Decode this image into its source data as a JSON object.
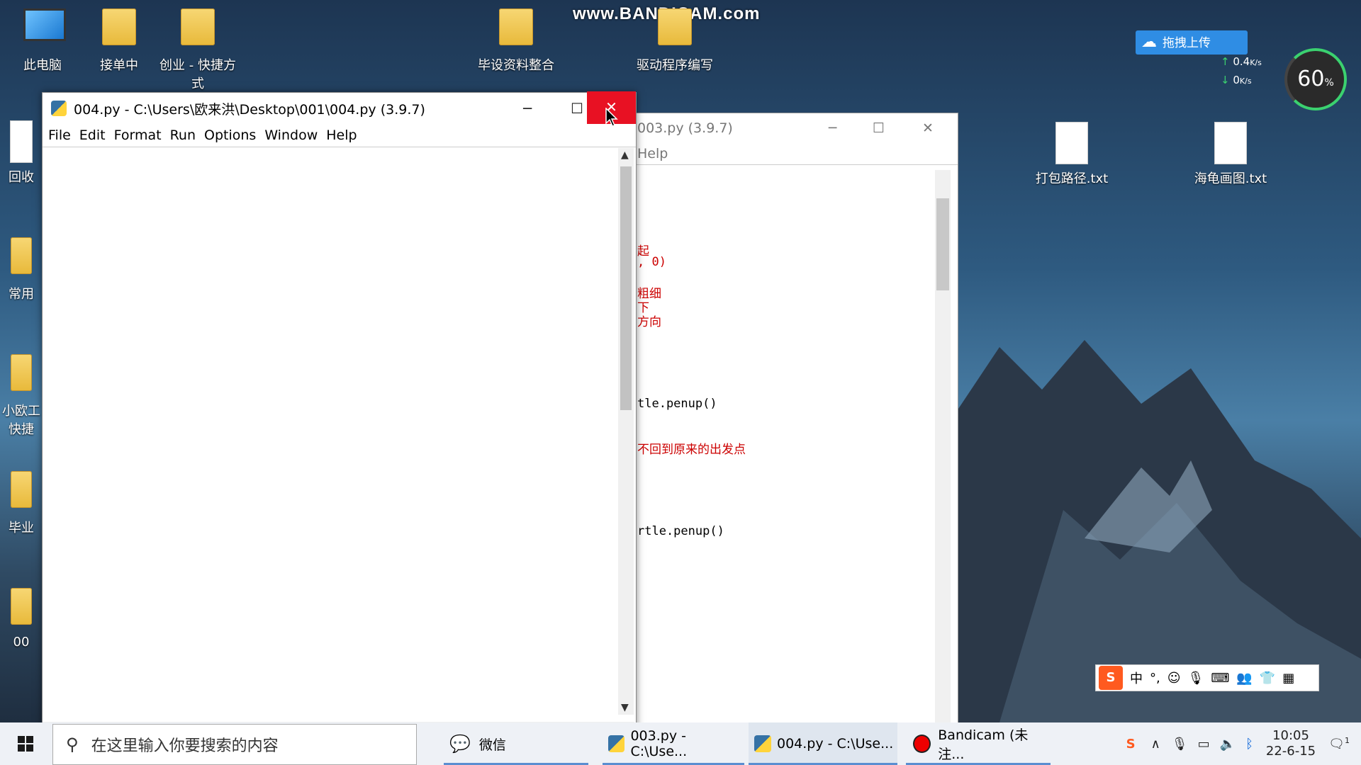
{
  "watermark": "www.BANDICAM.com",
  "desktop": {
    "icons_left": [
      {
        "label": "此电脑",
        "icon": "computer-icon"
      },
      {
        "label": "接单中",
        "icon": "folder-icon"
      },
      {
        "label": "创业 - 快捷方式",
        "icon": "folder-shortcut-icon"
      },
      {
        "label": "毕设资料整合",
        "icon": "folder-icon"
      },
      {
        "label": "驱动程序编写",
        "icon": "folder-icon"
      }
    ],
    "icons_partial": [
      "回收",
      "常用",
      "小欧工",
      "快捷",
      "毕业",
      "00"
    ],
    "icons_right": [
      {
        "label": "打包路径.txt",
        "icon": "text-file-icon"
      },
      {
        "label": "海龟画图.txt",
        "icon": "text-file-icon"
      }
    ]
  },
  "cloud_widget": {
    "label": "拖拽上传"
  },
  "net_widget": {
    "upload": "0.4",
    "upload_unit": "K/s",
    "download": "0",
    "download_unit": "K/s",
    "percent": "60",
    "percent_unit": "%"
  },
  "back_window": {
    "title": "003.py (3.9.7)",
    "menu_partial": "Help",
    "code_fragments": [
      "起",
      ", 0)",
      "粗细",
      "下",
      "方向",
      "tle.penup()",
      "不回到原来的出发点",
      "rtle.penup()"
    ]
  },
  "front_window": {
    "title": "004.py - C:\\Users\\欧来洪\\Desktop\\001\\004.py (3.9.7)",
    "menu": [
      "File",
      "Edit",
      "Format",
      "Run",
      "Options",
      "Window",
      "Help"
    ]
  },
  "ime": {
    "logo": "S",
    "mode": "中",
    "punct": "°,"
  },
  "taskbar": {
    "search_placeholder": "在这里输入你要搜索的内容",
    "apps": [
      {
        "label": "微信",
        "icon": "wechat-icon"
      },
      {
        "label": "003.py - C:\\Use...",
        "icon": "python-icon"
      },
      {
        "label": "004.py - C:\\Use...",
        "icon": "python-icon"
      },
      {
        "label": "Bandicam (未注...",
        "icon": "record-icon"
      }
    ],
    "time": "10:05",
    "date": "22-6-15",
    "notification_count": "1"
  }
}
